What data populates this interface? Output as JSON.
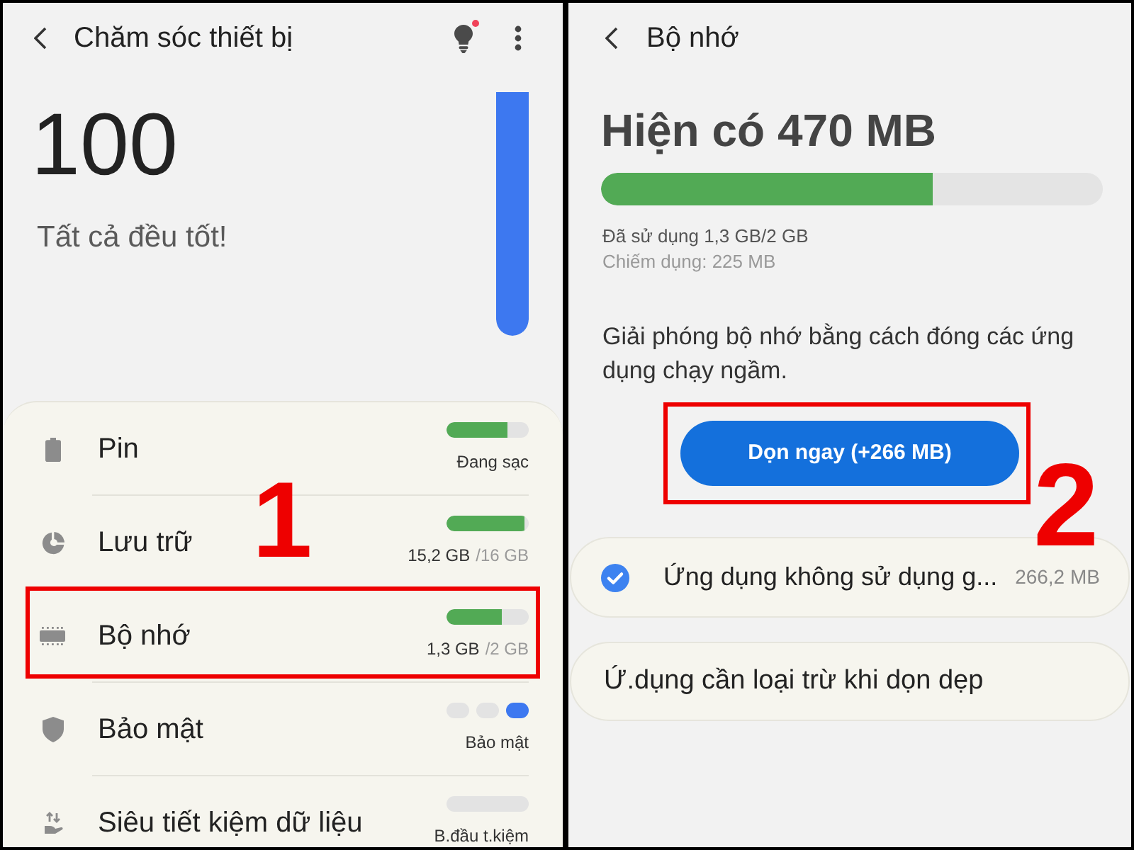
{
  "left_screen": {
    "title": "Chăm sóc thiết bị",
    "notification": true,
    "score": "100",
    "status": "Tất cả đều tốt!",
    "score_meter": {
      "level": 1
    },
    "items": [
      {
        "kind": "bar",
        "label": "Pin",
        "level": 0.74,
        "reading": "Đang sạc",
        "highlighted": false
      },
      {
        "kind": "bar",
        "label": "Lưu trữ",
        "level": 0.95,
        "reading": "15,2 GB",
        "reading_total": "/16 GB",
        "highlighted": false
      },
      {
        "kind": "bar",
        "label": "Bộ nhớ",
        "level": 0.67,
        "reading": "1,3 GB",
        "reading_total": "/2 GB",
        "highlighted": true
      },
      {
        "kind": "dots",
        "label": "Bảo mật",
        "dots": [
          {
            "on": false
          },
          {
            "on": false
          },
          {
            "on": true
          }
        ],
        "reading": "Bảo mật",
        "highlighted": false
      },
      {
        "kind": "inactive",
        "label": "Siêu tiết kiệm dữ liệu",
        "reading": "B.đầu t.kiệm",
        "highlighted": false
      }
    ],
    "step_label": "1"
  },
  "right_screen": {
    "title": "Bộ nhớ",
    "available": "Hiện có 470 MB",
    "usage_bar": {
      "level": 0.66
    },
    "used": "Đã sử dụng 1,3 GB/2 GB",
    "occupied": "Chiếm dụng: 225 MB",
    "description": "Giải phóng bộ nhớ bằng cách đóng các ứng dụng chạy ngầm.",
    "clean_button": {
      "label": "Dọn ngay (+266 MB)",
      "highlighted": true
    },
    "step_label": "2",
    "options": [
      {
        "kind": "check",
        "label": "Ứng dụng không sử dụng g...",
        "size": "266,2 MB",
        "checked": true
      },
      {
        "kind": "link",
        "label": "Ứ.dụng cần loại trừ khi dọn dẹp"
      }
    ]
  }
}
